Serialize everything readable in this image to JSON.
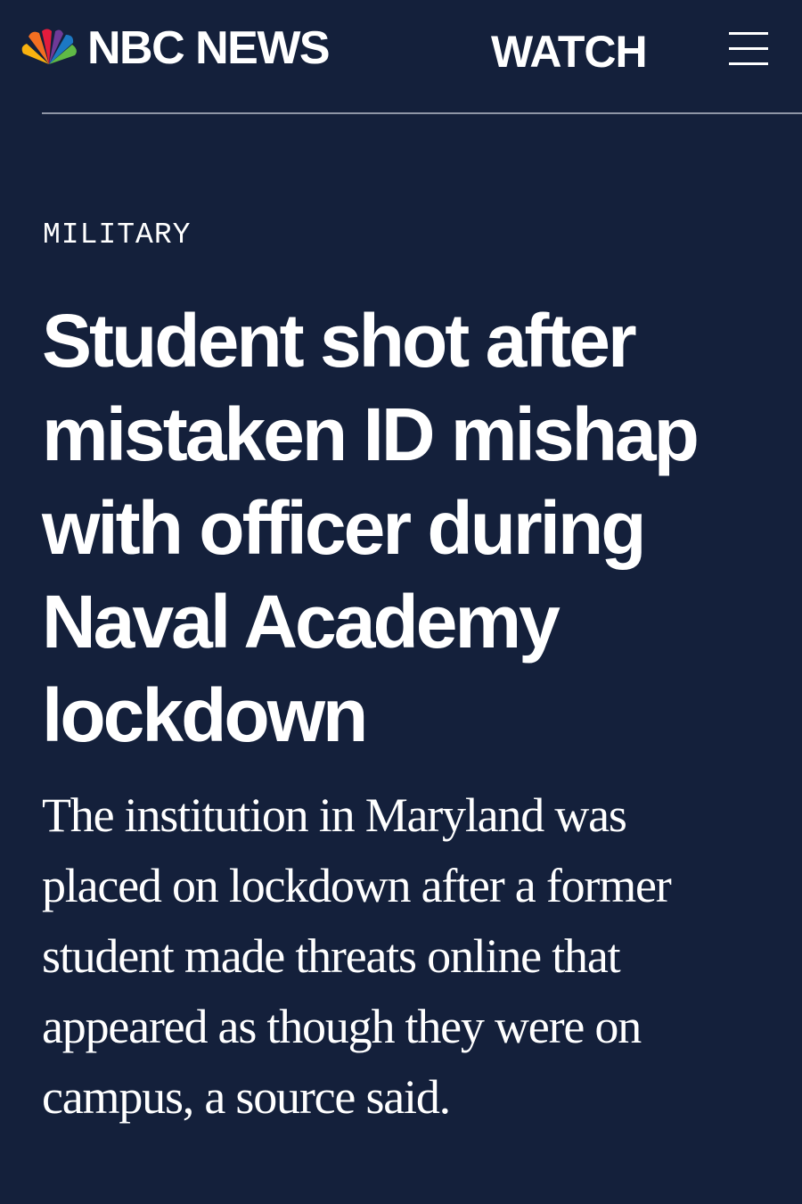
{
  "header": {
    "brand": "NBC NEWS",
    "logo_icon": "nbc-peacock-icon",
    "watch_label": "WATCH",
    "menu_icon": "hamburger-menu-icon"
  },
  "article": {
    "category": "MILITARY",
    "headline": "Student shot after mistaken ID mishap with officer during Naval Academy lockdown",
    "dek": "The institution in Maryland was placed on lockdown after a former student made threats online that appeared as though they were on campus, a source said."
  },
  "colors": {
    "background": "#14203b",
    "text": "#ffffff",
    "divider": "#8f96a6",
    "peacock": [
      "#f9b20f",
      "#f36f21",
      "#e31c3d",
      "#6f3a98",
      "#1c78c3",
      "#5fb946"
    ]
  }
}
